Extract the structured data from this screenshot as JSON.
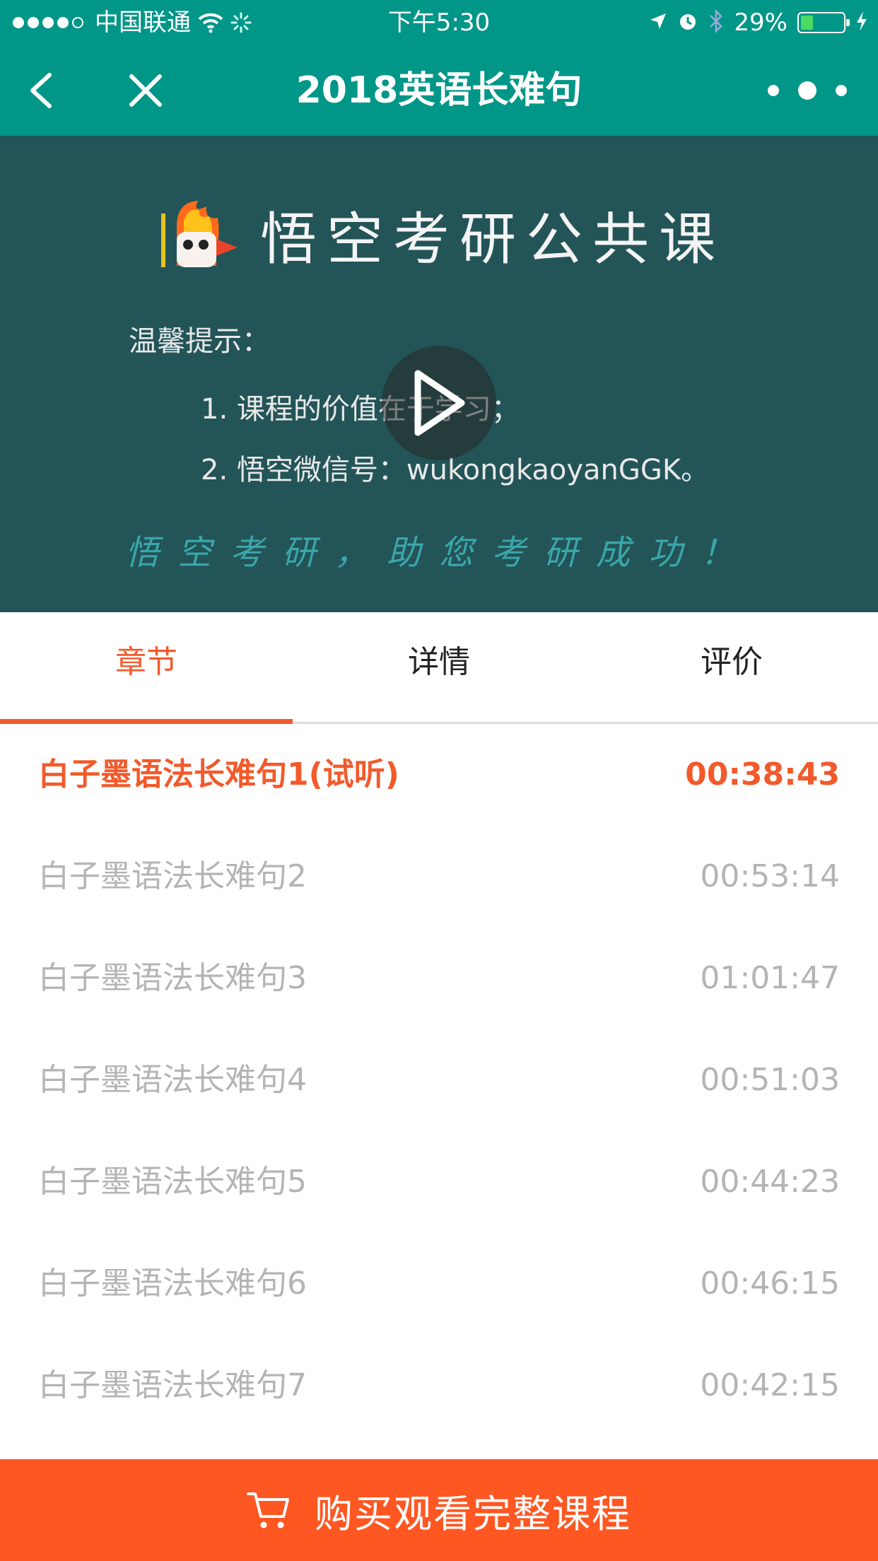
{
  "status_bar": {
    "carrier": "中国联通",
    "time": "下午5:30",
    "battery": "29%",
    "battery_level": 0.29
  },
  "nav": {
    "title": "2018英语长难句"
  },
  "video": {
    "brand": "悟空考研公共课",
    "tip_heading": "温馨提示：",
    "tip_1": "1. 课程的价值在于学习；",
    "tip_2": "2. 悟空微信号：wukongkaoyanGGK。",
    "slogan": "悟空考研，助您考研成功！"
  },
  "tabs": [
    {
      "label": "章节",
      "active": true
    },
    {
      "label": "详情",
      "active": false
    },
    {
      "label": "评价",
      "active": false
    }
  ],
  "chapters": [
    {
      "title": "白子墨语法长难句1(试听)",
      "duration": "00:38:43",
      "active": true
    },
    {
      "title": "白子墨语法长难句2",
      "duration": "00:53:14"
    },
    {
      "title": "白子墨语法长难句3",
      "duration": "01:01:47"
    },
    {
      "title": "白子墨语法长难句4",
      "duration": "00:51:03"
    },
    {
      "title": "白子墨语法长难句5",
      "duration": "00:44:23"
    },
    {
      "title": "白子墨语法长难句6",
      "duration": "00:46:15"
    },
    {
      "title": "白子墨语法长难句7",
      "duration": "00:42:15"
    }
  ],
  "buy": {
    "label": "购买观看完整课程"
  },
  "colors": {
    "header": "#009688",
    "accent": "#f25a2b",
    "buy_bar": "#ff5722",
    "video_bg": "#235458"
  }
}
